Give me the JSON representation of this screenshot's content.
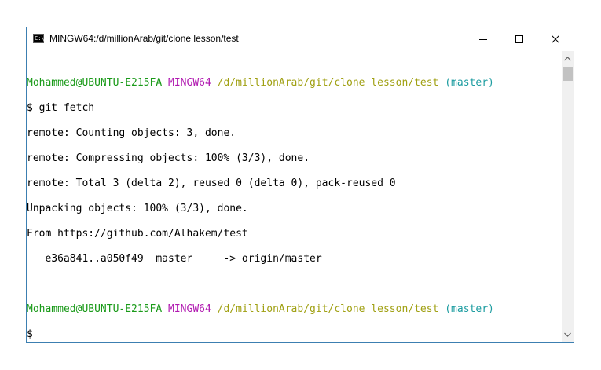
{
  "window": {
    "title": "MINGW64:/d/millionArab/git/clone lesson/test",
    "icon": "terminal-app-icon",
    "controls": {
      "minimize_icon": "minimize-icon",
      "maximize_icon": "maximize-icon",
      "close_icon": "close-icon"
    }
  },
  "colors": {
    "user_host": "#1a9a19",
    "system": "#b018b0",
    "path": "#a0a012",
    "branch": "#1c9ca0",
    "border": "#3c7fb1"
  },
  "terminal": {
    "prompt1": {
      "user_host": "Mohammed@UBUNTU-E215FA",
      "system": "MINGW64",
      "path": "/d/millionArab/git/clone lesson/test",
      "branch": "(master)"
    },
    "command1": "$ git fetch",
    "output": [
      "remote: Counting objects: 3, done.",
      "remote: Compressing objects: 100% (3/3), done.",
      "remote: Total 3 (delta 2), reused 0 (delta 0), pack-reused 0",
      "Unpacking objects: 100% (3/3), done.",
      "From https://github.com/Alhakem/test",
      "   e36a841..a050f49  master     -> origin/master"
    ],
    "prompt2": {
      "user_host": "Mohammed@UBUNTU-E215FA",
      "system": "MINGW64",
      "path": "/d/millionArab/git/clone lesson/test",
      "branch": "(master)"
    },
    "command2": "$"
  },
  "scrollbar": {
    "up_icon": "chevron-up-icon",
    "down_icon": "chevron-down-icon"
  }
}
